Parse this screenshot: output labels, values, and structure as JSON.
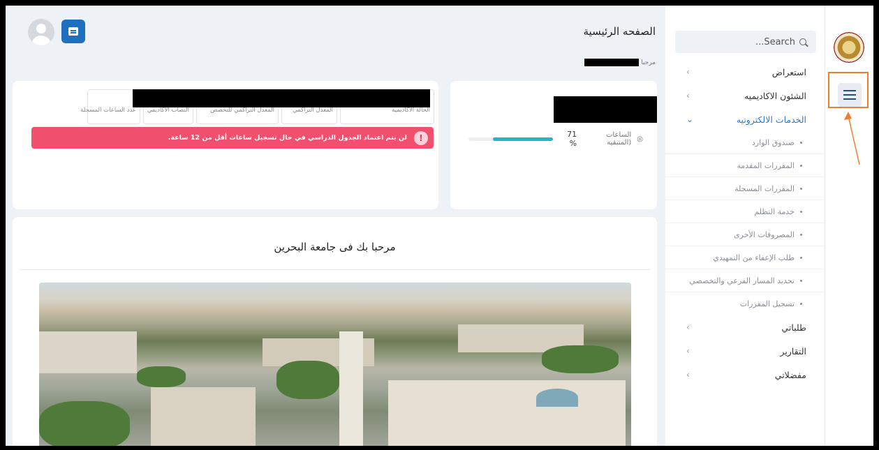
{
  "header": {
    "title": "الصفحه الرئيسية",
    "greeting": "مرحبا"
  },
  "search": {
    "placeholder": "...Search"
  },
  "sidebar": {
    "items": [
      {
        "label": "استعراض",
        "chevron": "›"
      },
      {
        "label": "الشئون الاكاديميه",
        "chevron": "›"
      },
      {
        "label": "الخدمات الالكترونيه",
        "chevron": "⌄"
      }
    ],
    "subitems": [
      "صندوق الوارد",
      "المقررات المقدمة",
      "المقررات المسجلة",
      "خدمة التظلم",
      "المصروفات الأخرى",
      "طلب الإعفاء من التمهيدي",
      "تحديد المسار الفرعي والتخصصي",
      "تسجيل المقررات"
    ],
    "after_items": [
      {
        "label": "طلباتي",
        "chevron": "›"
      },
      {
        "label": "التقارير",
        "chevron": "›"
      },
      {
        "label": "مفضلاتي",
        "chevron": "›"
      }
    ]
  },
  "hours_card": {
    "label": "الساعات (المتبقيه",
    "percent_label": "71 %",
    "progress": 0.71
  },
  "stats": [
    "الحالة الاكاديمية",
    "المعدل التراكمي",
    "المعدل التراكمي للتخصص",
    "النصاب الأكاديمي",
    "عدد الساعات المسجلة"
  ],
  "alert": {
    "text": "لن يتم اعتماد الجدول الدراسي في حال تسجيل ساعات أقل من 12 ساعة.",
    "icon": "!"
  },
  "welcome": {
    "title": "مرحبا بك فى جامعة البحرين"
  },
  "colors": {
    "accent": "#2b7ad3",
    "alert": "#f0506e",
    "progress": "#26b5c4",
    "annotation": "#ef7d2e"
  }
}
